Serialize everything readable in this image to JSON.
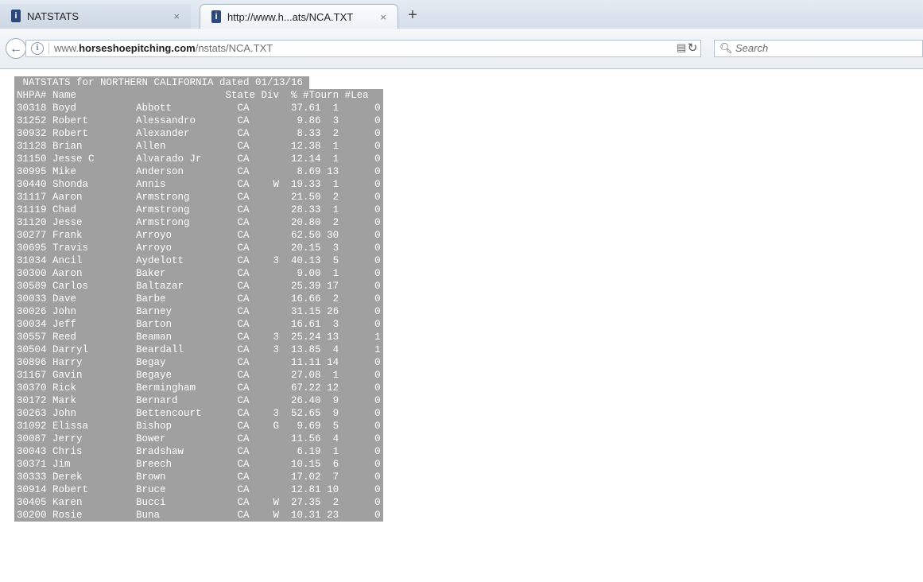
{
  "tabs": [
    {
      "title": "NATSTATS",
      "close_glyph": "×"
    },
    {
      "title": "http://www.h...ats/NCA.TXT",
      "close_glyph": "×"
    }
  ],
  "new_tab_glyph": "+",
  "address_bar": {
    "prefix": "www.",
    "domain": "horseshoepitching.com",
    "path": "/nstats/NCA.TXT"
  },
  "search": {
    "placeholder": "Search"
  },
  "document": {
    "title_line": " NATSTATS for NORTHERN CALIFORNIA dated 01/13/16 ",
    "header_line": "NHPA# Name                         State Div  % #Tourn #Lea",
    "rows": [
      "30318 Boyd          Abbott           CA       37.61  1      0",
      "31252 Robert        Alessandro       CA        9.86  3      0",
      "30932 Robert        Alexander        CA        8.33  2      0",
      "31128 Brian         Allen            CA       12.38  1      0",
      "31150 Jesse C       Alvarado Jr      CA       12.14  1      0",
      "30995 Mike          Anderson         CA        8.69 13      0",
      "30440 Shonda        Annis            CA    W  19.33  1      0",
      "31117 Aaron         Armstrong        CA       21.50  2      0",
      "31119 Chad          Armstrong        CA       28.33  1      0",
      "31120 Jesse         Armstrong        CA       20.80  2      0",
      "30277 Frank         Arroyo           CA       62.50 30      0",
      "30695 Travis        Arroyo           CA       20.15  3      0",
      "31034 Ancil         Aydelott         CA    3  40.13  5      0",
      "30300 Aaron         Baker            CA        9.00  1      0",
      "30589 Carlos        Baltazar         CA       25.39 17      0",
      "30033 Dave          Barbe            CA       16.66  2      0",
      "30026 John          Barney           CA       31.15 26      0",
      "30034 Jeff          Barton           CA       16.61  3      0",
      "30557 Reed          Beaman           CA    3  25.24 13      1",
      "30504 Darryl        Beardall         CA    3  13.85  4      1",
      "30896 Harry         Begay            CA       11.11 14      0",
      "31167 Gavin         Begaye           CA       27.08  1      0",
      "30370 Rick          Bermingham       CA       67.22 12      0",
      "30172 Mark          Bernard          CA       26.40  9      0",
      "30263 John          Bettencourt      CA    3  52.65  9      0",
      "31092 Elissa        Bishop           CA    G   9.69  5      0",
      "30087 Jerry         Bower            CA       11.56  4      0",
      "30043 Chris         Bradshaw         CA        6.19  1      0",
      "30371 Jim           Breech           CA       10.15  6      0",
      "30333 Derek         Brown            CA       17.02  7      0",
      "30914 Robert        Bruce            CA       12.81 10      0",
      "30405 Karen         Bucci            CA    W  27.35  2      0",
      "30200 Rosie         Buna             CA    W  10.31 23      0"
    ]
  }
}
